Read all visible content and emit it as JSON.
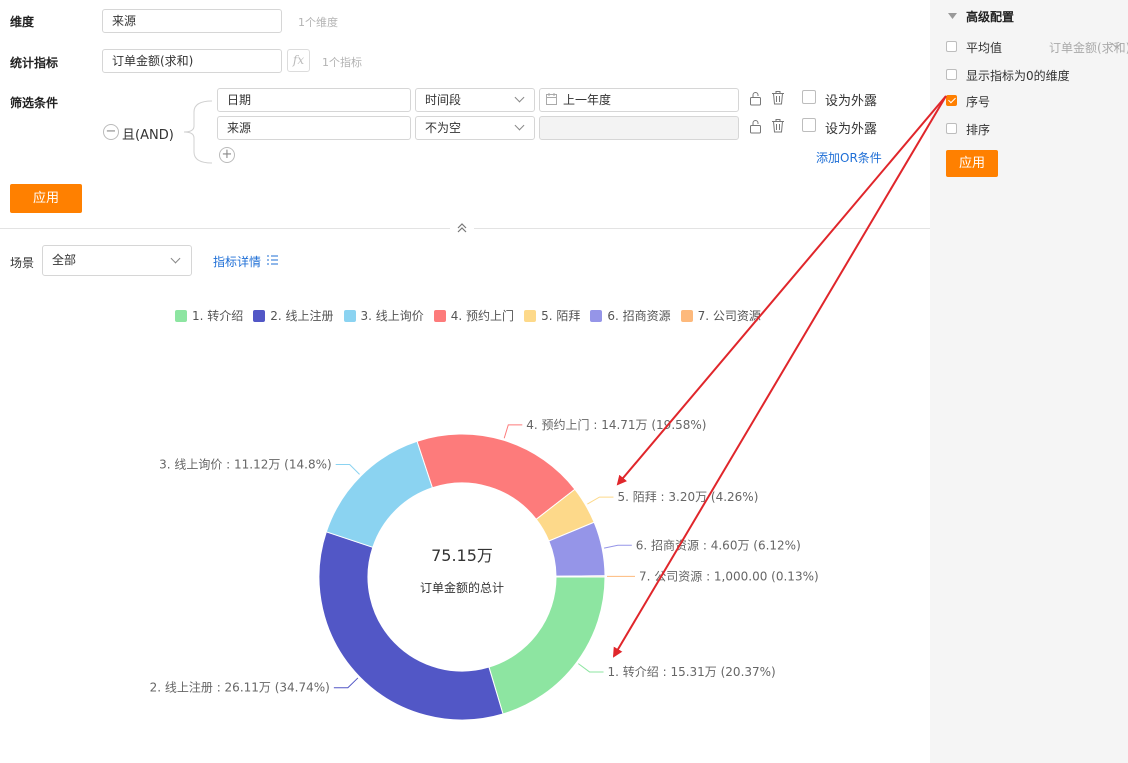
{
  "config": {
    "dimension": {
      "label": "维度",
      "value": "来源",
      "hint": "1个维度"
    },
    "metric": {
      "label": "统计指标",
      "value": "订单金额(求和)",
      "fx_label": "fx",
      "hint": "1个指标"
    },
    "filter": {
      "label": "筛选条件",
      "logic": "且(AND)",
      "rows": [
        {
          "field": "日期",
          "operator": "时间段",
          "value": "上一年度",
          "expose_label": "设为外露"
        },
        {
          "field": "来源",
          "operator": "不为空",
          "value": "",
          "expose_label": "设为外露"
        }
      ],
      "add_or_label": "添加OR条件"
    },
    "apply_label": "应用"
  },
  "scene": {
    "label": "场景",
    "selected": "全部",
    "metric_detail_label": "指标详情"
  },
  "side_panel": {
    "title": "高级配置",
    "options": [
      {
        "label": "平均值",
        "extra": "订单金额(求和)",
        "checked": false
      },
      {
        "label": "显示指标为0的维度",
        "checked": false
      },
      {
        "label": "序号",
        "checked": true
      },
      {
        "label": "排序",
        "checked": false
      }
    ],
    "apply_label": "应用"
  },
  "chart_data": {
    "type": "pie",
    "variant": "donut",
    "center_value": "75.15万",
    "center_label": "订单金额的总计",
    "legend_position": "top",
    "slices": [
      {
        "name": "1. 转介绍",
        "value": 153100,
        "label": "15.31万",
        "percent": "20.37%",
        "color": "#8de5a1"
      },
      {
        "name": "2. 线上注册",
        "value": 261100,
        "label": "26.11万",
        "percent": "34.74%",
        "color": "#5257c6"
      },
      {
        "name": "3. 线上询价",
        "value": 111200,
        "label": "11.12万",
        "percent": "14.8%",
        "color": "#8bd3f1"
      },
      {
        "name": "4. 预约上门",
        "value": 147100,
        "label": "14.71万",
        "percent": "19.58%",
        "color": "#fd7b7b"
      },
      {
        "name": "5. 陌拜",
        "value": 32000,
        "label": "3.20万",
        "percent": "4.26%",
        "color": "#fdd98a"
      },
      {
        "name": "6. 招商资源",
        "value": 46000,
        "label": "4.60万",
        "percent": "6.12%",
        "color": "#9595e8"
      },
      {
        "name": "7. 公司资源",
        "value": 1000,
        "label": "1,000.00",
        "percent": "0.13%",
        "color": "#fdb97c"
      }
    ]
  },
  "annotation": {
    "arrow_color": "#e0262b"
  }
}
